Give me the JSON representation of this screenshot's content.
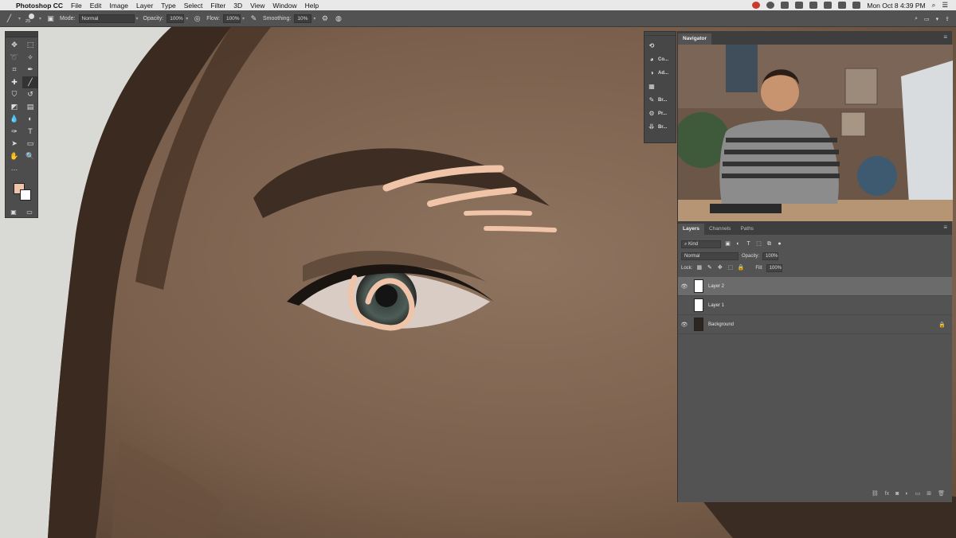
{
  "menubar": {
    "app_name": "Photoshop CC",
    "items": [
      "File",
      "Edit",
      "Image",
      "Layer",
      "Type",
      "Select",
      "Filter",
      "3D",
      "View",
      "Window",
      "Help"
    ],
    "clock": "Mon Oct 8  4:39 PM"
  },
  "options": {
    "brush_size": "25",
    "mode_label": "Mode:",
    "mode_value": "Normal",
    "opacity_label": "Opacity:",
    "opacity_value": "100%",
    "flow_label": "Flow:",
    "flow_value": "100%",
    "smoothing_label": "Smoothing:",
    "smoothing_value": "10%"
  },
  "tools": {
    "foreground_color": "#f0c4a8",
    "background_color": "#ffffff"
  },
  "dock": {
    "items": [
      {
        "icon": "history-icon",
        "label": ""
      },
      {
        "icon": "color-icon",
        "label": "Co..."
      },
      {
        "icon": "adjustments-icon",
        "label": "Ad..."
      },
      {
        "icon": "measure-icon",
        "label": ""
      },
      {
        "icon": "brush-settings-icon",
        "label": "Br..."
      },
      {
        "icon": "presets-icon",
        "label": "Pr..."
      },
      {
        "icon": "brushes-icon",
        "label": "Br..."
      }
    ]
  },
  "navigator": {
    "tab_label": "Navigator"
  },
  "layers_panel": {
    "tabs": [
      "Layers",
      "Channels",
      "Paths"
    ],
    "filter_value": "Kind",
    "blend_mode": "Normal",
    "opacity_label": "Opacity:",
    "opacity_value": "100%",
    "lock_label": "Lock:",
    "fill_label": "Fill:",
    "fill_value": "100%",
    "layers": [
      {
        "name": "Layer 2",
        "visible": true,
        "selected": true,
        "locked": false
      },
      {
        "name": "Layer 1",
        "visible": false,
        "selected": false,
        "locked": false
      },
      {
        "name": "Background",
        "visible": true,
        "selected": false,
        "locked": true
      }
    ]
  }
}
